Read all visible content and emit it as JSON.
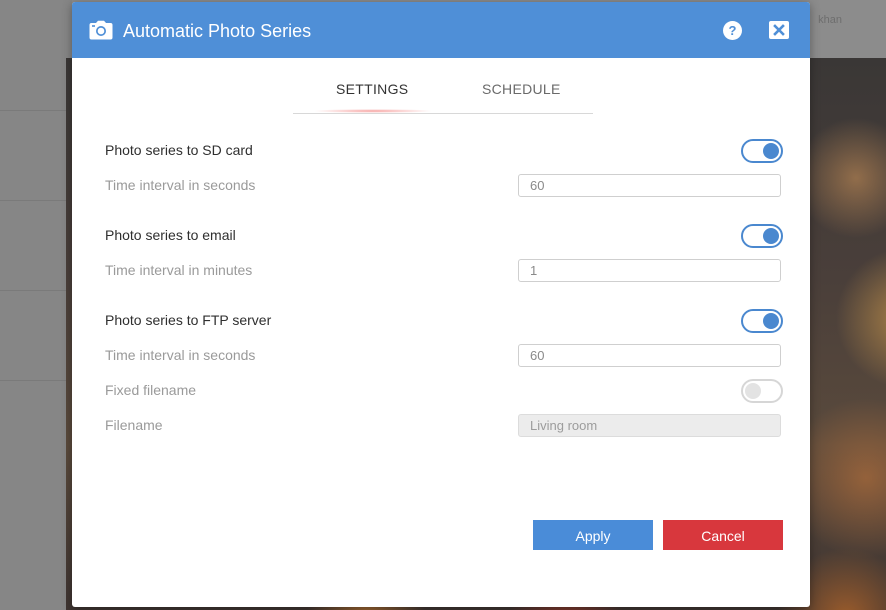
{
  "background": {
    "header_text": "khan"
  },
  "dialog": {
    "title": "Automatic Photo Series",
    "help_glyph": "?",
    "icons": {
      "title_icon": "camera-icon",
      "help": "help-icon",
      "close": "close-icon"
    }
  },
  "tabs": [
    {
      "label": "SETTINGS",
      "active": true
    },
    {
      "label": "SCHEDULE",
      "active": false
    }
  ],
  "sections": {
    "sd_card": {
      "label": "Photo series to SD card",
      "enabled": true,
      "interval_label": "Time interval in seconds",
      "interval_value": "60"
    },
    "email": {
      "label": "Photo series to email",
      "enabled": true,
      "interval_label": "Time interval in minutes",
      "interval_value": "1"
    },
    "ftp": {
      "label": "Photo series to FTP server",
      "enabled": true,
      "interval_label": "Time interval in seconds",
      "interval_value": "60",
      "fixed_filename_label": "Fixed filename",
      "fixed_filename_enabled": false,
      "filename_label": "Filename",
      "filename_placeholder": "Living room"
    }
  },
  "buttons": {
    "apply": "Apply",
    "cancel": "Cancel"
  },
  "colors": {
    "header": "#4f8fd7",
    "toggle_on": "#4a88cf",
    "apply": "#4a8cd8",
    "cancel": "#d8373d"
  }
}
